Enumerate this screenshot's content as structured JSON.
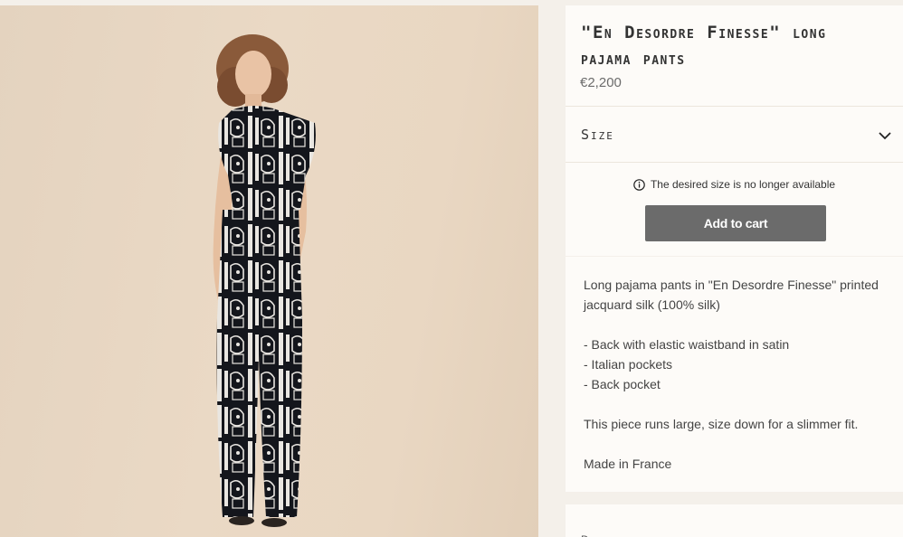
{
  "product": {
    "title": "\"En Desordre Finesse\" long pajama pants",
    "price": "€2,200"
  },
  "size_selector": {
    "label": "Size",
    "icon": "chevron-down-icon"
  },
  "availability": {
    "message": "The desired size is no longer available",
    "icon": "info-icon"
  },
  "cart": {
    "button_label": "Add to cart",
    "button_color": "#6b6b6b"
  },
  "description": {
    "intro": "Long pajama pants in \"En Desordre Finesse\" printed jacquard silk (100% silk)",
    "features": [
      "- Back with elastic waistband in satin",
      "- Italian pockets",
      "- Back pocket"
    ],
    "fit_note": "This piece runs large, size down for a slimmer fit.",
    "origin": "Made in France"
  },
  "next_panel": {
    "partial_text": "D"
  },
  "colors": {
    "page_bg": "#f4f0ea",
    "panel_bg": "#fdfbf8",
    "photo_bg": "#e6d5c1"
  }
}
